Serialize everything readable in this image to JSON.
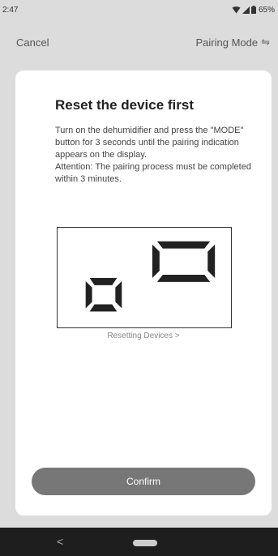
{
  "status_bar": {
    "time": "2:47",
    "battery": "65%",
    "icons": [
      "wifi-icon",
      "signal-icon",
      "battery-icon"
    ]
  },
  "header": {
    "cancel_label": "Cancel",
    "mode_label": "Pairing Mode",
    "mode_icon": "swap-icon"
  },
  "card": {
    "title": "Reset the device first",
    "description_1": "Turn on the dehumidifier and press the \"MODE\" button for 3 seconds until the pairing indication appears on the display.",
    "description_2": "Attention: The pairing process must be completed within 3 minutes.",
    "link_label": "Resetting Devices",
    "link_chevron": ">"
  },
  "confirm_label": "Confirm",
  "nav": {
    "back_glyph": "<"
  }
}
